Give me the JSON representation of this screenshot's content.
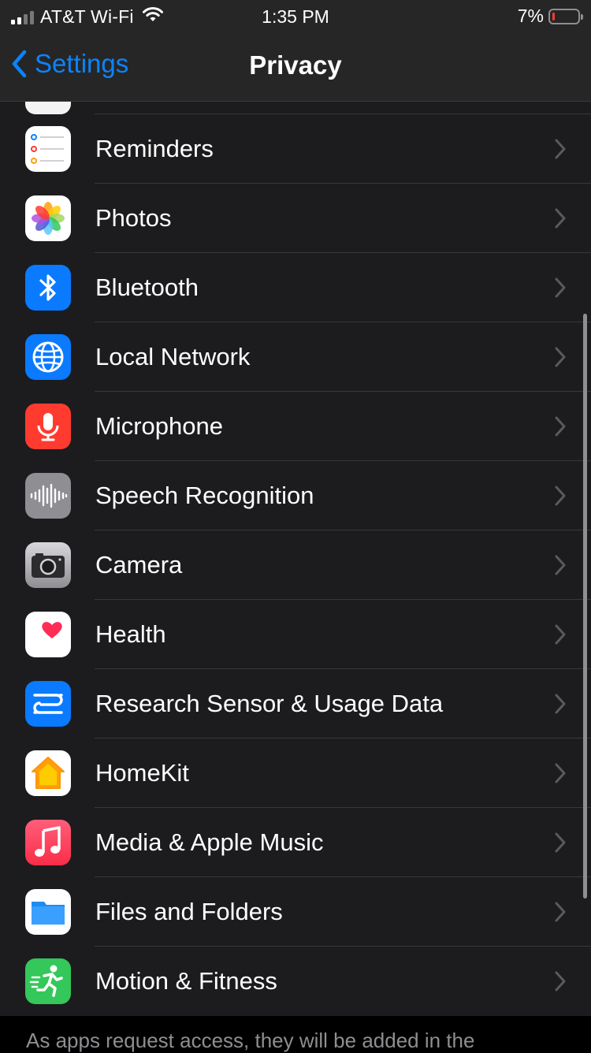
{
  "status_bar": {
    "carrier": "AT&T Wi-Fi",
    "time": "1:35 PM",
    "battery_percent": "7%",
    "battery_level": 0.07,
    "battery_color": "#ff3b30"
  },
  "nav": {
    "back_label": "Settings",
    "title": "Privacy"
  },
  "rows": [
    {
      "label": "Reminders",
      "icon": "reminders-icon"
    },
    {
      "label": "Photos",
      "icon": "photos-icon"
    },
    {
      "label": "Bluetooth",
      "icon": "bluetooth-icon"
    },
    {
      "label": "Local Network",
      "icon": "globe-icon"
    },
    {
      "label": "Microphone",
      "icon": "microphone-icon"
    },
    {
      "label": "Speech Recognition",
      "icon": "waveform-icon"
    },
    {
      "label": "Camera",
      "icon": "camera-icon"
    },
    {
      "label": "Health",
      "icon": "heart-icon"
    },
    {
      "label": "Research Sensor & Usage Data",
      "icon": "research-icon"
    },
    {
      "label": "HomeKit",
      "icon": "home-icon"
    },
    {
      "label": "Media & Apple Music",
      "icon": "music-note-icon"
    },
    {
      "label": "Files and Folders",
      "icon": "folder-icon"
    },
    {
      "label": "Motion & Fitness",
      "icon": "running-figure-icon"
    }
  ],
  "footer": {
    "text": "As apps request access, they will be added in the"
  },
  "colors": {
    "accent": "#0a84ff",
    "background": "#000000",
    "cell": "#1c1c1e",
    "separator": "#38383a"
  }
}
